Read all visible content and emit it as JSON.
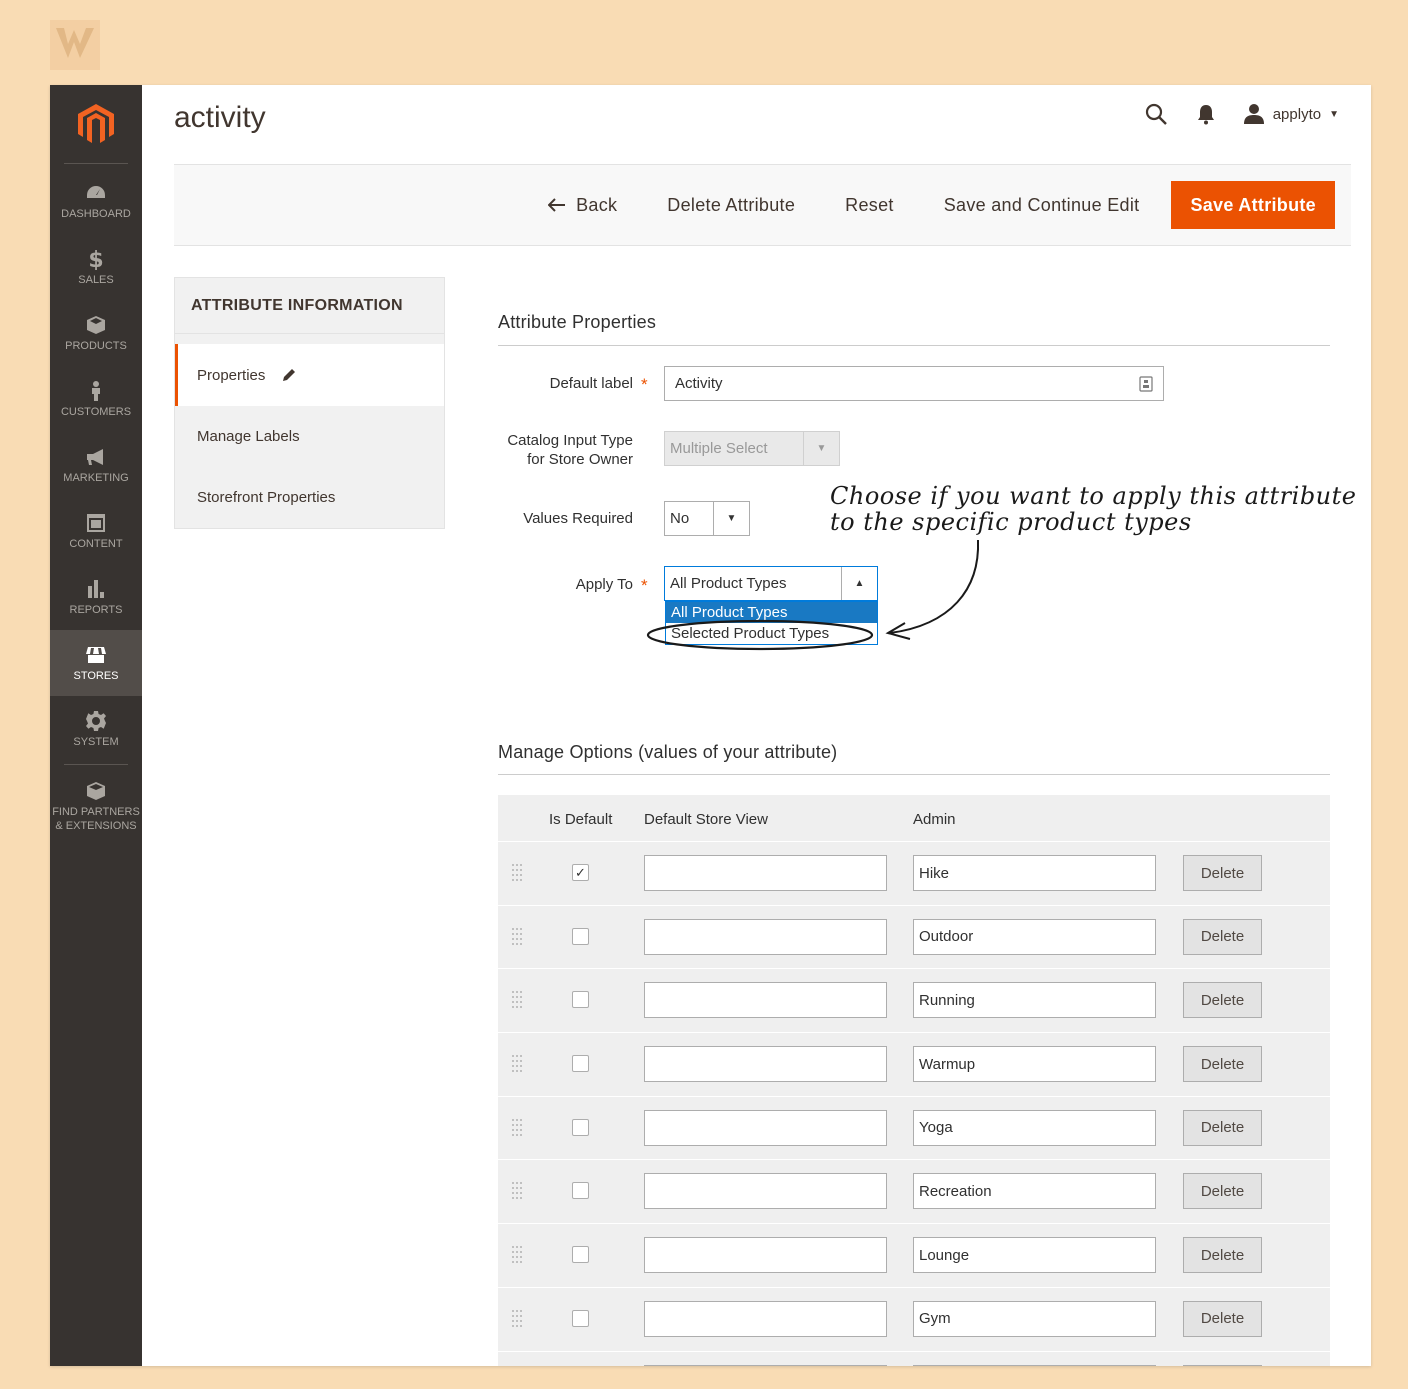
{
  "header": {
    "page_title": "activity",
    "user_name": "applyto"
  },
  "sidebar": {
    "items": [
      {
        "label": "Dashboard",
        "icon": "dashboard-icon"
      },
      {
        "label": "Sales",
        "icon": "dollar-icon"
      },
      {
        "label": "Products",
        "icon": "cube-icon"
      },
      {
        "label": "Customers",
        "icon": "person-icon"
      },
      {
        "label": "Marketing",
        "icon": "megaphone-icon"
      },
      {
        "label": "Content",
        "icon": "layout-icon"
      },
      {
        "label": "Reports",
        "icon": "bar-chart-icon"
      },
      {
        "label": "Stores",
        "icon": "store-icon"
      },
      {
        "label": "System",
        "icon": "gear-icon"
      },
      {
        "label": "Find Partners & Extensions",
        "icon": "box-icon"
      }
    ],
    "active": "Stores"
  },
  "actions": {
    "back": "Back",
    "delete": "Delete Attribute",
    "reset": "Reset",
    "save_continue": "Save and Continue Edit",
    "save": "Save Attribute"
  },
  "tabs": {
    "heading": "ATTRIBUTE INFORMATION",
    "items": [
      "Properties",
      "Manage Labels",
      "Storefront Properties"
    ]
  },
  "properties": {
    "title": "Attribute Properties",
    "default_label": {
      "label": "Default label",
      "value": "Activity"
    },
    "input_type": {
      "label_line1": "Catalog Input Type",
      "label_line2": "for Store Owner",
      "value": "Multiple Select"
    },
    "values_required": {
      "label": "Values Required",
      "value": "No"
    },
    "apply_to": {
      "label": "Apply To",
      "value": "All Product Types",
      "options": [
        "All Product Types",
        "Selected Product Types"
      ]
    }
  },
  "annotation": {
    "line1": "Choose if you want to apply this attribute",
    "line2": "to the specific product types"
  },
  "options": {
    "title": "Manage Options (values of your attribute)",
    "columns": {
      "is_default": "Is Default",
      "store_view": "Default Store View",
      "admin": "Admin"
    },
    "delete_label": "Delete",
    "rows": [
      {
        "admin": "Hike",
        "default": true
      },
      {
        "admin": "Outdoor",
        "default": false
      },
      {
        "admin": "Running",
        "default": false
      },
      {
        "admin": "Warmup",
        "default": false
      },
      {
        "admin": "Yoga",
        "default": false
      },
      {
        "admin": "Recreation",
        "default": false
      },
      {
        "admin": "Lounge",
        "default": false
      },
      {
        "admin": "Gym",
        "default": false
      },
      {
        "admin": "",
        "default": false
      }
    ]
  },
  "colors": {
    "accent": "#eb5202",
    "sidebar": "#373330",
    "highlight": "#1979c3"
  }
}
